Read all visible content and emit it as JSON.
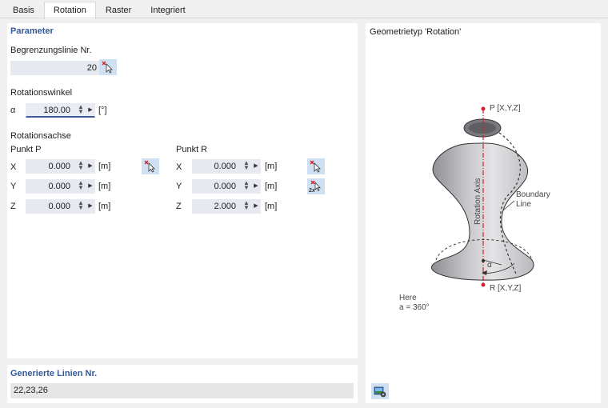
{
  "tabs": [
    "Basis",
    "Rotation",
    "Raster",
    "Integriert"
  ],
  "parameter": {
    "title": "Parameter",
    "boundary_label": "Begrenzungslinie Nr.",
    "boundary_value": "20",
    "rotation_angle_label": "Rotationswinkel",
    "alpha_symbol": "α",
    "alpha_value": "180.00",
    "alpha_unit": "[°]",
    "axis_label": "Rotationsachse",
    "point_p": {
      "label": "Punkt P",
      "x_label": "X",
      "x_value": "0.000",
      "y_label": "Y",
      "y_value": "0.000",
      "z_label": "Z",
      "z_value": "0.000",
      "unit": "[m]"
    },
    "point_r": {
      "label": "Punkt R",
      "x_label": "X",
      "x_value": "0.000",
      "y_label": "Y",
      "y_value": "0.000",
      "z_label": "Z",
      "z_value": "2.000",
      "unit": "[m]"
    }
  },
  "generated": {
    "title": "Generierte Linien Nr.",
    "value": "22,23,26"
  },
  "geometry": {
    "title": "Geometrietyp 'Rotation'",
    "p_label": "P [X,Y,Z]",
    "r_label": "R [X,Y,Z]",
    "axis_text": "Rotation Axis",
    "boundary_line_1": "Boundary",
    "boundary_line_2": "Line",
    "angle_symbol": "α",
    "here_text": "Here",
    "here_value": "a = 360°"
  },
  "colors": {
    "section_title": "#33599a",
    "field_bg": "#e6eaf0",
    "button_bg": "#cfe0f3",
    "axis_red": "#d0202a"
  },
  "icons": {
    "pick": "pick-node-icon",
    "pick_two": "pick-two-nodes-icon",
    "bottom": "image-settings-icon"
  }
}
